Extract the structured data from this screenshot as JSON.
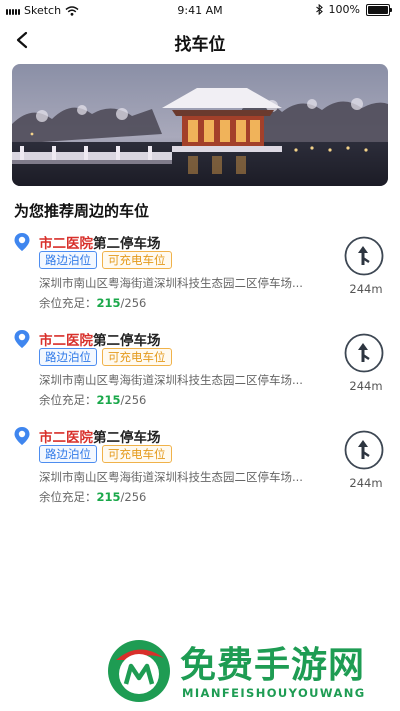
{
  "status_bar": {
    "carrier": "Sketch",
    "time": "9:41 AM",
    "battery": "100%"
  },
  "nav": {
    "title": "找车位"
  },
  "banner": {
    "alt": ""
  },
  "section": {
    "title": "为您推荐周边的车位"
  },
  "lots": [
    {
      "name_highlight": "市二医院",
      "name_rest": "第二停车场",
      "tags": [
        "路边泊位",
        "可充电车位"
      ],
      "address": "深圳市南山区粤海街道深圳科技生态园二区停车场...",
      "avail_label": "余位充足：",
      "avail_free": "215",
      "avail_total": "/256",
      "distance": "244m"
    },
    {
      "name_highlight": "市二医院",
      "name_rest": "第二停车场",
      "tags": [
        "路边泊位",
        "可充电车位"
      ],
      "address": "深圳市南山区粤海街道深圳科技生态园二区停车场...",
      "avail_label": "余位充足：",
      "avail_free": "215",
      "avail_total": "/256",
      "distance": "244m"
    },
    {
      "name_highlight": "市二医院",
      "name_rest": "第二停车场",
      "tags": [
        "路边泊位",
        "可充电车位"
      ],
      "address": "深圳市南山区粤海街道深圳科技生态园二区停车场...",
      "avail_label": "余位充足：",
      "avail_free": "215",
      "avail_total": "/256",
      "distance": "244m"
    }
  ],
  "watermark": {
    "cn": "免费手游网",
    "en": "MIANFEISHOUYOUWANG"
  },
  "colors": {
    "highlight": "#d8302b",
    "free": "#1aa84a",
    "tag_blue": "#2f79e8",
    "tag_orange": "#e49a1c",
    "watermark": "#1e9c53"
  },
  "icons": [
    "back-icon",
    "location-pin-icon",
    "navigation-turn-icon",
    "wifi-icon",
    "bluetooth-icon",
    "battery-icon"
  ]
}
